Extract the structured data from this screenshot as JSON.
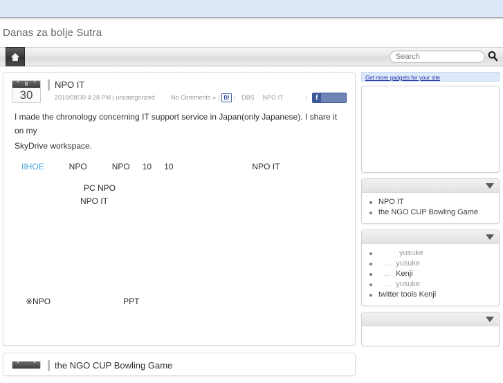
{
  "topbar": {
    "label": ""
  },
  "site": {
    "title": "Danas za bolje Sutra"
  },
  "nav": {
    "home_icon": "home-icon",
    "search": {
      "placeholder": "Search",
      "value": "",
      "button_icon": "search-icon"
    }
  },
  "posts": [
    {
      "calendar": {
        "month": "8",
        "day": "30"
      },
      "title": "NPO  IT",
      "meta": {
        "date": "2010/08/30 4:28 PM | uncategorized",
        "comments": "No Comments »",
        "hatena_badge": "B!",
        "dbs": "DBS",
        "tag": "NPO  IT",
        "facebook_label": ""
      },
      "body": {
        "paragraph_1": "I made the chronology concerning IT support service in Japan(only Japanese). I share it on my",
        "paragraph_2": "SkyDrive workspace.",
        "links_row": {
          "link": "IIHOE",
          "item_1": "NPO",
          "item_2": "NPO",
          "item_3": "10",
          "item_4": "10",
          "item_5": "NPO IT"
        },
        "indent_line_1": "PC NPO",
        "indent_line_2": "NPO  IT",
        "note_label": "※NPO",
        "note_value": "PPT"
      }
    },
    {
      "calendar": {
        "month": "",
        "day": ""
      },
      "title": "the NGO CUP Bowling Game"
    }
  ],
  "sidebar": {
    "gadget_link": "Get more gadgets for your site",
    "widgets": [
      {
        "name": "gadget-frame",
        "toggle_icon": "chevron-down-icon",
        "items": []
      },
      {
        "name": "recent-posts",
        "toggle_icon": "chevron-down-icon",
        "items": [
          {
            "text": "NPO  IT",
            "muted": false,
            "indent": 0
          },
          {
            "text": "the NGO CUP Bowling Game",
            "muted": false,
            "indent": 0
          },
          {
            "text": "",
            "muted": false,
            "indent": 0
          },
          {
            "text": "",
            "muted": false,
            "indent": 0
          },
          {
            "text": "",
            "muted": false,
            "indent": 0
          }
        ]
      },
      {
        "name": "recent-comments",
        "toggle_icon": "chevron-down-icon",
        "items": [
          {
            "prefix": "",
            "text": "yusuke",
            "muted": true,
            "indent": 2
          },
          {
            "prefix": "...",
            "text": "yusuke",
            "muted": true,
            "indent": 1
          },
          {
            "prefix": "...",
            "text": "Kenji",
            "muted": false,
            "indent": 1
          },
          {
            "prefix": "...",
            "text": "yusuke",
            "muted": true,
            "indent": 1
          },
          {
            "prefix": "",
            "text": "twitter tools  Kenji",
            "muted": false,
            "indent": 0
          }
        ]
      },
      {
        "name": "archives",
        "toggle_icon": "chevron-down-icon",
        "items": []
      }
    ]
  },
  "colors": {
    "topbar": "#dee8f8",
    "link": "#4aa3df",
    "gadget_link": "#2233aa",
    "facebook": "#3b5998",
    "hatena": "#2a4b9b"
  }
}
